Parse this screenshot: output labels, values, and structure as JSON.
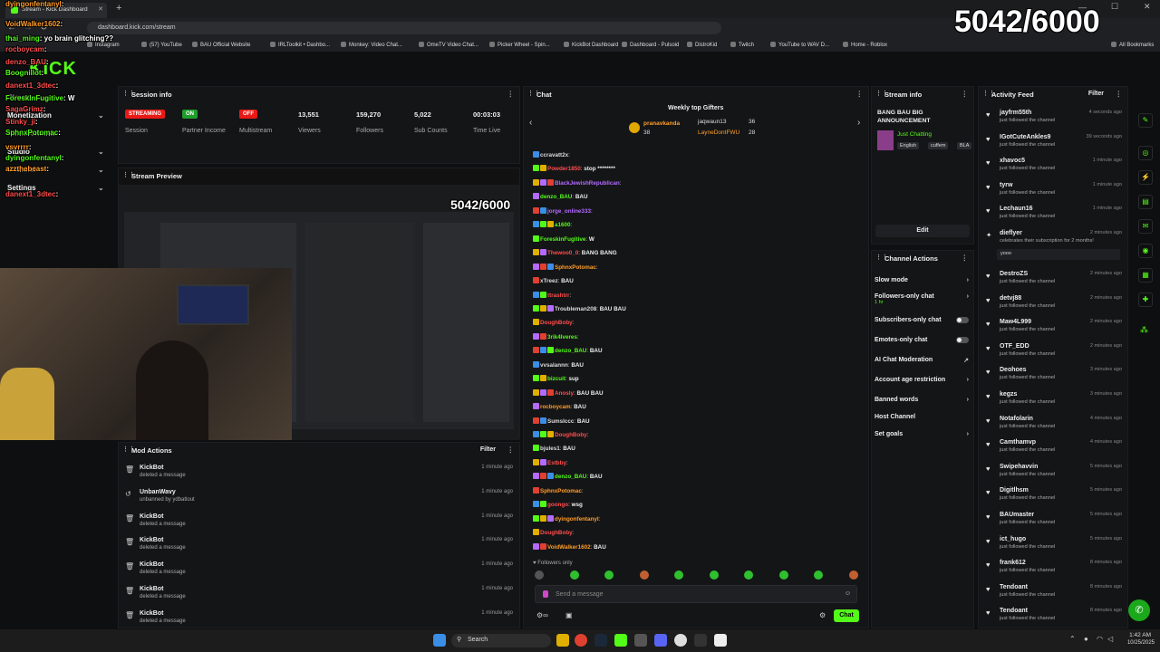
{
  "browser": {
    "tab_title": "Stream - Kick Dashboard",
    "url": "dashboard.kick.com/stream",
    "bookmarks": [
      "Instagram",
      "(57) YouTube",
      "BAU Official Website",
      "IRLToolkit • Dashbo...",
      "Monkey: Video Chat...",
      "OmeTV Video Chat...",
      "Picker Wheel - Spin...",
      "KickBot Dashboard",
      "Dashboard - Pulsoid",
      "DistroKid",
      "Twitch",
      "YouTube to WAV D...",
      "Home - Roblox",
      "All Bookmarks"
    ]
  },
  "overlay": {
    "counter": "5042/6000",
    "chat_overlay": [
      {
        "user": "dyingonfentanyl",
        "text": ""
      },
      {
        "user": "VoidWalker1602",
        "text": ""
      },
      {
        "user": "thai_ming",
        "text": "yo brain glitching??"
      },
      {
        "user": "rocboycam",
        "text": ""
      },
      {
        "user": "denzo_BAU",
        "text": ""
      },
      {
        "user": "Boognillot",
        "text": ""
      },
      {
        "user": "danext1_3dtec",
        "text": ""
      },
      {
        "user": "ForeskinFugitive",
        "text": "W"
      },
      {
        "user": "SagaGrimz",
        "text": ""
      },
      {
        "user": "Stinky_ji",
        "text": ""
      },
      {
        "user": "SphnxPotomac",
        "text": ""
      },
      {
        "user": "vsvrrrr",
        "text": ""
      },
      {
        "user": "dyingonfentanyl",
        "text": ""
      },
      {
        "user": "azzthebeast",
        "text": ""
      },
      {
        "user": "danext1_3dtec",
        "text": ""
      }
    ]
  },
  "sidebar": {
    "logo": "KICK",
    "items": [
      {
        "label": "Stream"
      },
      {
        "label": "Monetization"
      },
      {
        "label": "Achievements"
      },
      {
        "label": "Studio"
      },
      {
        "label": "Channel"
      },
      {
        "label": "Settings"
      }
    ]
  },
  "session": {
    "title": "Session info",
    "stats": [
      {
        "badge": "STREAMING",
        "label": "Session",
        "color": "#e91916"
      },
      {
        "badge": "ON",
        "label": "Partner Income",
        "color": "#1f9e2c"
      },
      {
        "badge": "OFF",
        "label": "Multistream",
        "color": "#e91916"
      },
      {
        "value": "13,551",
        "label": "Viewers"
      },
      {
        "value": "159,270",
        "label": "Followers"
      },
      {
        "value": "5,022",
        "label": "Sub Counts"
      },
      {
        "value": "00:03:03",
        "label": "Time Live"
      }
    ]
  },
  "preview": {
    "title": "Stream Preview",
    "counter": "5042/6000"
  },
  "mod_actions": {
    "title": "Mod Actions",
    "filter": "Filter",
    "items": [
      {
        "user": "KickBot",
        "action": "deleted a message",
        "time": "1 minute ago"
      },
      {
        "user": "UnbanWavy",
        "action": "unbanned by ydbatlout",
        "time": "1 minute ago"
      },
      {
        "user": "KickBot",
        "action": "deleted a message",
        "time": "1 minute ago"
      },
      {
        "user": "KickBot",
        "action": "deleted a message",
        "time": "1 minute ago"
      },
      {
        "user": "KickBot",
        "action": "deleted a message",
        "time": "1 minute ago"
      },
      {
        "user": "KickBot",
        "action": "deleted a message",
        "time": "1 minute ago"
      },
      {
        "user": "KickBot",
        "action": "deleted a message",
        "time": "1 minute ago"
      }
    ]
  },
  "chat": {
    "title": "Chat",
    "gifters_title": "Weekly top Gifters",
    "gifters": [
      {
        "name": "pranavkanda",
        "count": "38"
      },
      {
        "name": "jaqwaun13",
        "count": "36"
      },
      {
        "name": "LayneDontFWU",
        "count": "28"
      }
    ],
    "messages": [
      {
        "user": "ccravatt2x",
        "text": "",
        "color": "#ddd"
      },
      {
        "user": "Powder1850",
        "text": "stop ********",
        "color": "#ff4d4d"
      },
      {
        "user": "BlackJewishRepublican",
        "text": "",
        "color": "#b36bff"
      },
      {
        "user": "denzo_BAU",
        "text": "BAU",
        "color": "#53fc18"
      },
      {
        "user": "jorge_online333",
        "text": "",
        "color": "#b36bff"
      },
      {
        "user": "a1600",
        "text": "",
        "color": "#53fc18"
      },
      {
        "user": "ForeskinFugitive",
        "text": "W",
        "color": "#53fc18"
      },
      {
        "user": "Thewoo0_0",
        "text": "BANG BANG",
        "color": "#ff4d4d"
      },
      {
        "user": "SphnxPotomac",
        "text": "",
        "color": "#ff9d2a"
      },
      {
        "user": "xTreez",
        "text": "BAU",
        "color": "#ddd"
      },
      {
        "user": "ttrashtrr",
        "text": "",
        "color": "#ff4d4d"
      },
      {
        "user": "Troubleman208",
        "text": "BAU BAU",
        "color": "#ddd"
      },
      {
        "user": "DoughBoby",
        "text": "",
        "color": "#ff4d4d"
      },
      {
        "user": "3rik4lveres",
        "text": "",
        "color": "#53fc18"
      },
      {
        "user": "denzo_BAU",
        "text": "BAU",
        "color": "#53fc18"
      },
      {
        "user": "vvsalannn",
        "text": "BAU",
        "color": "#ddd"
      },
      {
        "user": "bizcuit",
        "text": "sup",
        "color": "#53fc18"
      },
      {
        "user": "Anosly",
        "text": "BAU BAU",
        "color": "#ff4d4d"
      },
      {
        "user": "rocboycam",
        "text": "BAU",
        "color": "#ff9d2a"
      },
      {
        "user": "Sumslccc",
        "text": "BAU",
        "color": "#ddd"
      },
      {
        "user": "DoughBoby",
        "text": "",
        "color": "#ff4d4d"
      },
      {
        "user": "bjules1",
        "text": "BAU",
        "color": "#ddd"
      },
      {
        "user": "Estbby",
        "text": "",
        "color": "#ff4d4d"
      },
      {
        "user": "denzo_BAU",
        "text": "BAU",
        "color": "#53fc18"
      },
      {
        "user": "SphnxPotomac",
        "text": "",
        "color": "#ff9d2a"
      },
      {
        "user": "goongo",
        "text": "wsg",
        "color": "#ff4d4d"
      },
      {
        "user": "dyingonfentanyl",
        "text": "",
        "color": "#ff9d2a"
      },
      {
        "user": "DoughBoby",
        "text": "",
        "color": "#ff4d4d"
      },
      {
        "user": "VoidWalker1602",
        "text": "BAU",
        "color": "#ff9d2a"
      }
    ],
    "followers_only": "Followers only",
    "input_placeholder": "Send a message",
    "send_label": "Chat"
  },
  "stream_info": {
    "title": "Stream info",
    "stream_title": "BANG BAU BIG ANNOUNCEMENT",
    "category": "Just Chatting",
    "tags": [
      "English",
      "cuffem",
      "BLA"
    ],
    "edit_label": "Edit"
  },
  "channel_actions": {
    "title": "Channel Actions",
    "items": [
      {
        "label": "Slow mode",
        "kind": "arrow"
      },
      {
        "label": "Followers-only chat",
        "sub": "1 hr",
        "kind": "arrow"
      },
      {
        "label": "Subscribers-only chat",
        "kind": "toggle"
      },
      {
        "label": "Emotes-only chat",
        "kind": "toggle"
      },
      {
        "label": "AI Chat Moderation",
        "kind": "link"
      },
      {
        "label": "Account age restriction",
        "kind": "arrow"
      },
      {
        "label": "Banned words",
        "kind": "arrow"
      },
      {
        "label": "Host Channel",
        "kind": "none"
      },
      {
        "label": "Set goals",
        "kind": "arrow"
      }
    ]
  },
  "activity": {
    "title": "Activity Feed",
    "filter": "Filter",
    "items": [
      {
        "user": "jayfrm55th",
        "action": "just followed the channel",
        "time": "4 seconds ago"
      },
      {
        "user": "IGotCuteAnkles9",
        "action": "just followed the channel",
        "time": "39 seconds ago"
      },
      {
        "user": "xhavoc5",
        "action": "just followed the channel",
        "time": "1 minute ago"
      },
      {
        "user": "tyrw",
        "action": "just followed the channel",
        "time": "1 minute ago"
      },
      {
        "user": "Lechaun16",
        "action": "just followed the channel",
        "time": "1 minute ago"
      },
      {
        "user": "dieflyer",
        "action": "celebrates their subscription for 2 months!",
        "time": "2 minutes ago",
        "message": "yooo"
      },
      {
        "user": "DestroZS",
        "action": "just followed the channel",
        "time": "2 minutes ago"
      },
      {
        "user": "detvj88",
        "action": "just followed the channel",
        "time": "2 minutes ago"
      },
      {
        "user": "Maw4L999",
        "action": "just followed the channel",
        "time": "2 minutes ago"
      },
      {
        "user": "OTF_EDD",
        "action": "just followed the channel",
        "time": "2 minutes ago"
      },
      {
        "user": "Deohoes",
        "action": "just followed the channel",
        "time": "3 minutes ago"
      },
      {
        "user": "kegzs",
        "action": "just followed the channel",
        "time": "3 minutes ago"
      },
      {
        "user": "Notafolarin",
        "action": "just followed the channel",
        "time": "4 minutes ago"
      },
      {
        "user": "Camthamvp",
        "action": "just followed the channel",
        "time": "4 minutes ago"
      },
      {
        "user": "Swipehavvin",
        "action": "just followed the channel",
        "time": "5 minutes ago"
      },
      {
        "user": "Digitlhsm",
        "action": "just followed the channel",
        "time": "5 minutes ago"
      },
      {
        "user": "BAUmaster",
        "action": "just followed the channel",
        "time": "5 minutes ago"
      },
      {
        "user": "ict_hugo",
        "action": "just followed the channel",
        "time": "5 minutes ago"
      },
      {
        "user": "frank612",
        "action": "just followed the channel",
        "time": "8 minutes ago"
      },
      {
        "user": "Tendoant",
        "action": "just followed the channel",
        "time": "8 minutes ago"
      },
      {
        "user": "Tendoant",
        "action": "just followed the channel",
        "time": "8 minutes ago"
      }
    ]
  },
  "taskbar": {
    "search": "Search",
    "time": "1:42 AM",
    "date": "10/25/2025"
  },
  "colors": {
    "accent": "#53fc18",
    "danger": "#e91916"
  }
}
